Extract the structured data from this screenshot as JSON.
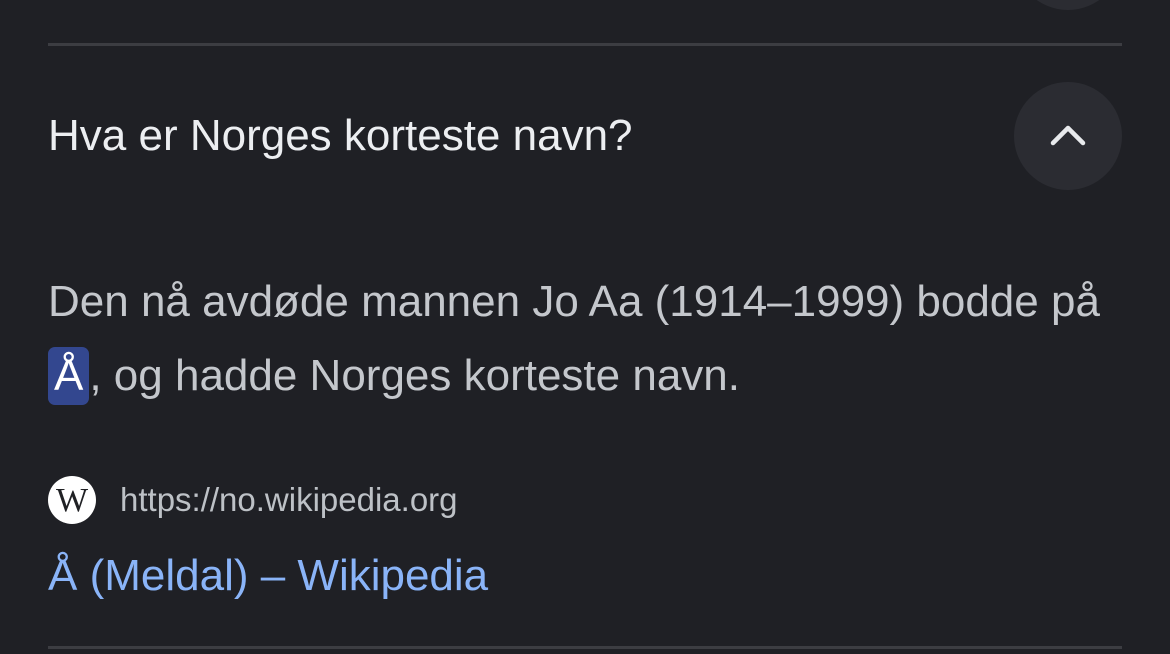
{
  "faq": {
    "question": "Hva er Norges korteste navn?",
    "expanded": true,
    "collapse_icon": "chevron-up-icon",
    "answer": {
      "before": "Den nå avdøde mannen Jo Aa (1914–1999) bodde på ",
      "highlight": "Å",
      "after": ", og hadde Norges korteste navn."
    },
    "source": {
      "favicon_icon": "wikipedia-icon",
      "favicon_glyph": "W",
      "url": "https://no.wikipedia.org",
      "title": "Å (Meldal) – Wikipedia"
    }
  },
  "colors": {
    "background": "#1f2025",
    "highlight_bg": "#33478f",
    "link": "#8ab4f8",
    "divider": "#3c3d42"
  }
}
